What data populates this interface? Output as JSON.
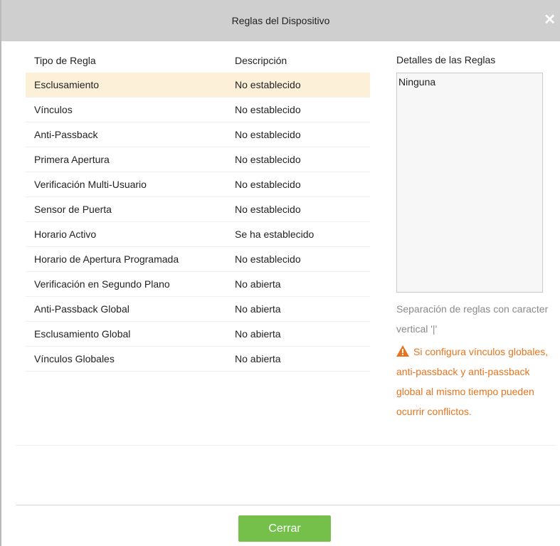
{
  "dialog": {
    "title": "Reglas del Dispositivo",
    "close_icon": "close-icon"
  },
  "table": {
    "headers": [
      "Tipo de Regla",
      "Descripción"
    ],
    "rows": [
      {
        "type": "Esclusamiento",
        "desc": "No establecido",
        "selected": true
      },
      {
        "type": "Vínculos",
        "desc": "No establecido"
      },
      {
        "type": "Anti-Passback",
        "desc": "No establecido"
      },
      {
        "type": "Primera Apertura",
        "desc": "No establecido"
      },
      {
        "type": "Verificación Multi-Usuario",
        "desc": "No establecido"
      },
      {
        "type": "Sensor de Puerta",
        "desc": "No establecido"
      },
      {
        "type": "Horario Activo",
        "desc": "Se ha establecido"
      },
      {
        "type": "Horario de Apertura Programada",
        "desc": "No establecido"
      },
      {
        "type": "Verificación en Segundo Plano",
        "desc": "No abierta"
      },
      {
        "type": "Anti-Passback Global",
        "desc": "No abierta"
      },
      {
        "type": "Esclusamiento Global",
        "desc": "No abierta"
      },
      {
        "type": "Vínculos Globales",
        "desc": "No abierta"
      }
    ]
  },
  "details": {
    "label": "Detalles de las Reglas",
    "value": "Ninguna",
    "separator_note": "Separación de reglas con caracter vertical '|'",
    "warning_icon": "warning-icon",
    "warning_text": "Si configura vínculos globales, anti-passback y anti-passback global al mismo tiempo pueden ocurrir conflictos."
  },
  "footer": {
    "close_label": "Cerrar"
  },
  "colors": {
    "accent_button": "#74c04b",
    "selected_row": "#fdf0d9",
    "warning": "#e8731c"
  }
}
